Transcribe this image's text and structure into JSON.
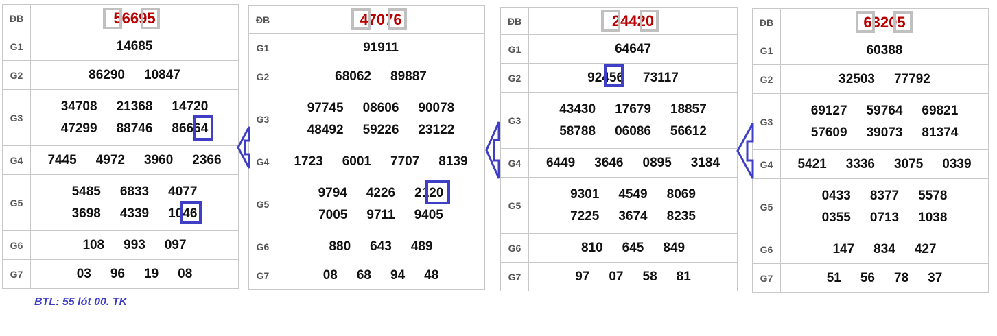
{
  "note": "BTL: 55 lót 00. TK",
  "tables": [
    {
      "db": "56695",
      "g1": [
        "14685"
      ],
      "g2": [
        "86290",
        "10847"
      ],
      "g3": [
        [
          "34708",
          "21368",
          "14720"
        ],
        [
          "47299",
          "88746",
          "86664"
        ]
      ],
      "g4": [
        "7445",
        "4972",
        "3960",
        "2366"
      ],
      "g5": [
        [
          "5485",
          "6833",
          "4077"
        ],
        [
          "3698",
          "4339",
          "1046"
        ]
      ],
      "g6": [
        "108",
        "993",
        "097"
      ],
      "g7": [
        "03",
        "96",
        "19",
        "08"
      ]
    },
    {
      "db": "47076",
      "g1": [
        "91911"
      ],
      "g2": [
        "68062",
        "89887"
      ],
      "g3": [
        [
          "97745",
          "08606",
          "90078"
        ],
        [
          "48492",
          "59226",
          "23122"
        ]
      ],
      "g4": [
        "1723",
        "6001",
        "7707",
        "8139"
      ],
      "g5": [
        [
          "9794",
          "4226",
          "2120"
        ],
        [
          "7005",
          "9711",
          "9405"
        ]
      ],
      "g6": [
        "880",
        "643",
        "489"
      ],
      "g7": [
        "08",
        "68",
        "94",
        "48"
      ]
    },
    {
      "db": "24420",
      "g1": [
        "64647"
      ],
      "g2": [
        "92456",
        "73117"
      ],
      "g3": [
        [
          "43430",
          "17679",
          "18857"
        ],
        [
          "58788",
          "06086",
          "56612"
        ]
      ],
      "g4": [
        "6449",
        "3646",
        "0895",
        "3184"
      ],
      "g5": [
        [
          "9301",
          "4549",
          "8069"
        ],
        [
          "7225",
          "3674",
          "8235"
        ]
      ],
      "g6": [
        "810",
        "645",
        "849"
      ],
      "g7": [
        "97",
        "07",
        "58",
        "81"
      ]
    },
    {
      "db": "63205",
      "g1": [
        "60388"
      ],
      "g2": [
        "32503",
        "77792"
      ],
      "g3": [
        [
          "69127",
          "59764",
          "69821"
        ],
        [
          "57609",
          "39073",
          "81374"
        ]
      ],
      "g4": [
        "5421",
        "3336",
        "3075",
        "0339"
      ],
      "g5": [
        [
          "0433",
          "8377",
          "5578"
        ],
        [
          "0355",
          "0713",
          "1038"
        ]
      ],
      "g6": [
        "147",
        "834",
        "427"
      ],
      "g7": [
        "51",
        "56",
        "78",
        "37"
      ]
    }
  ],
  "labels": {
    "db": "ĐB",
    "g1": "G1",
    "g2": "G2",
    "g3": "G3",
    "g4": "G4",
    "g5": "G5",
    "g6": "G6",
    "g7": "G7"
  },
  "colors": {
    "special_prize": "#b80000",
    "highlight_box": "#3f3fc6",
    "gray_box": "#c0c0c0",
    "note": "#3c3cc8"
  }
}
